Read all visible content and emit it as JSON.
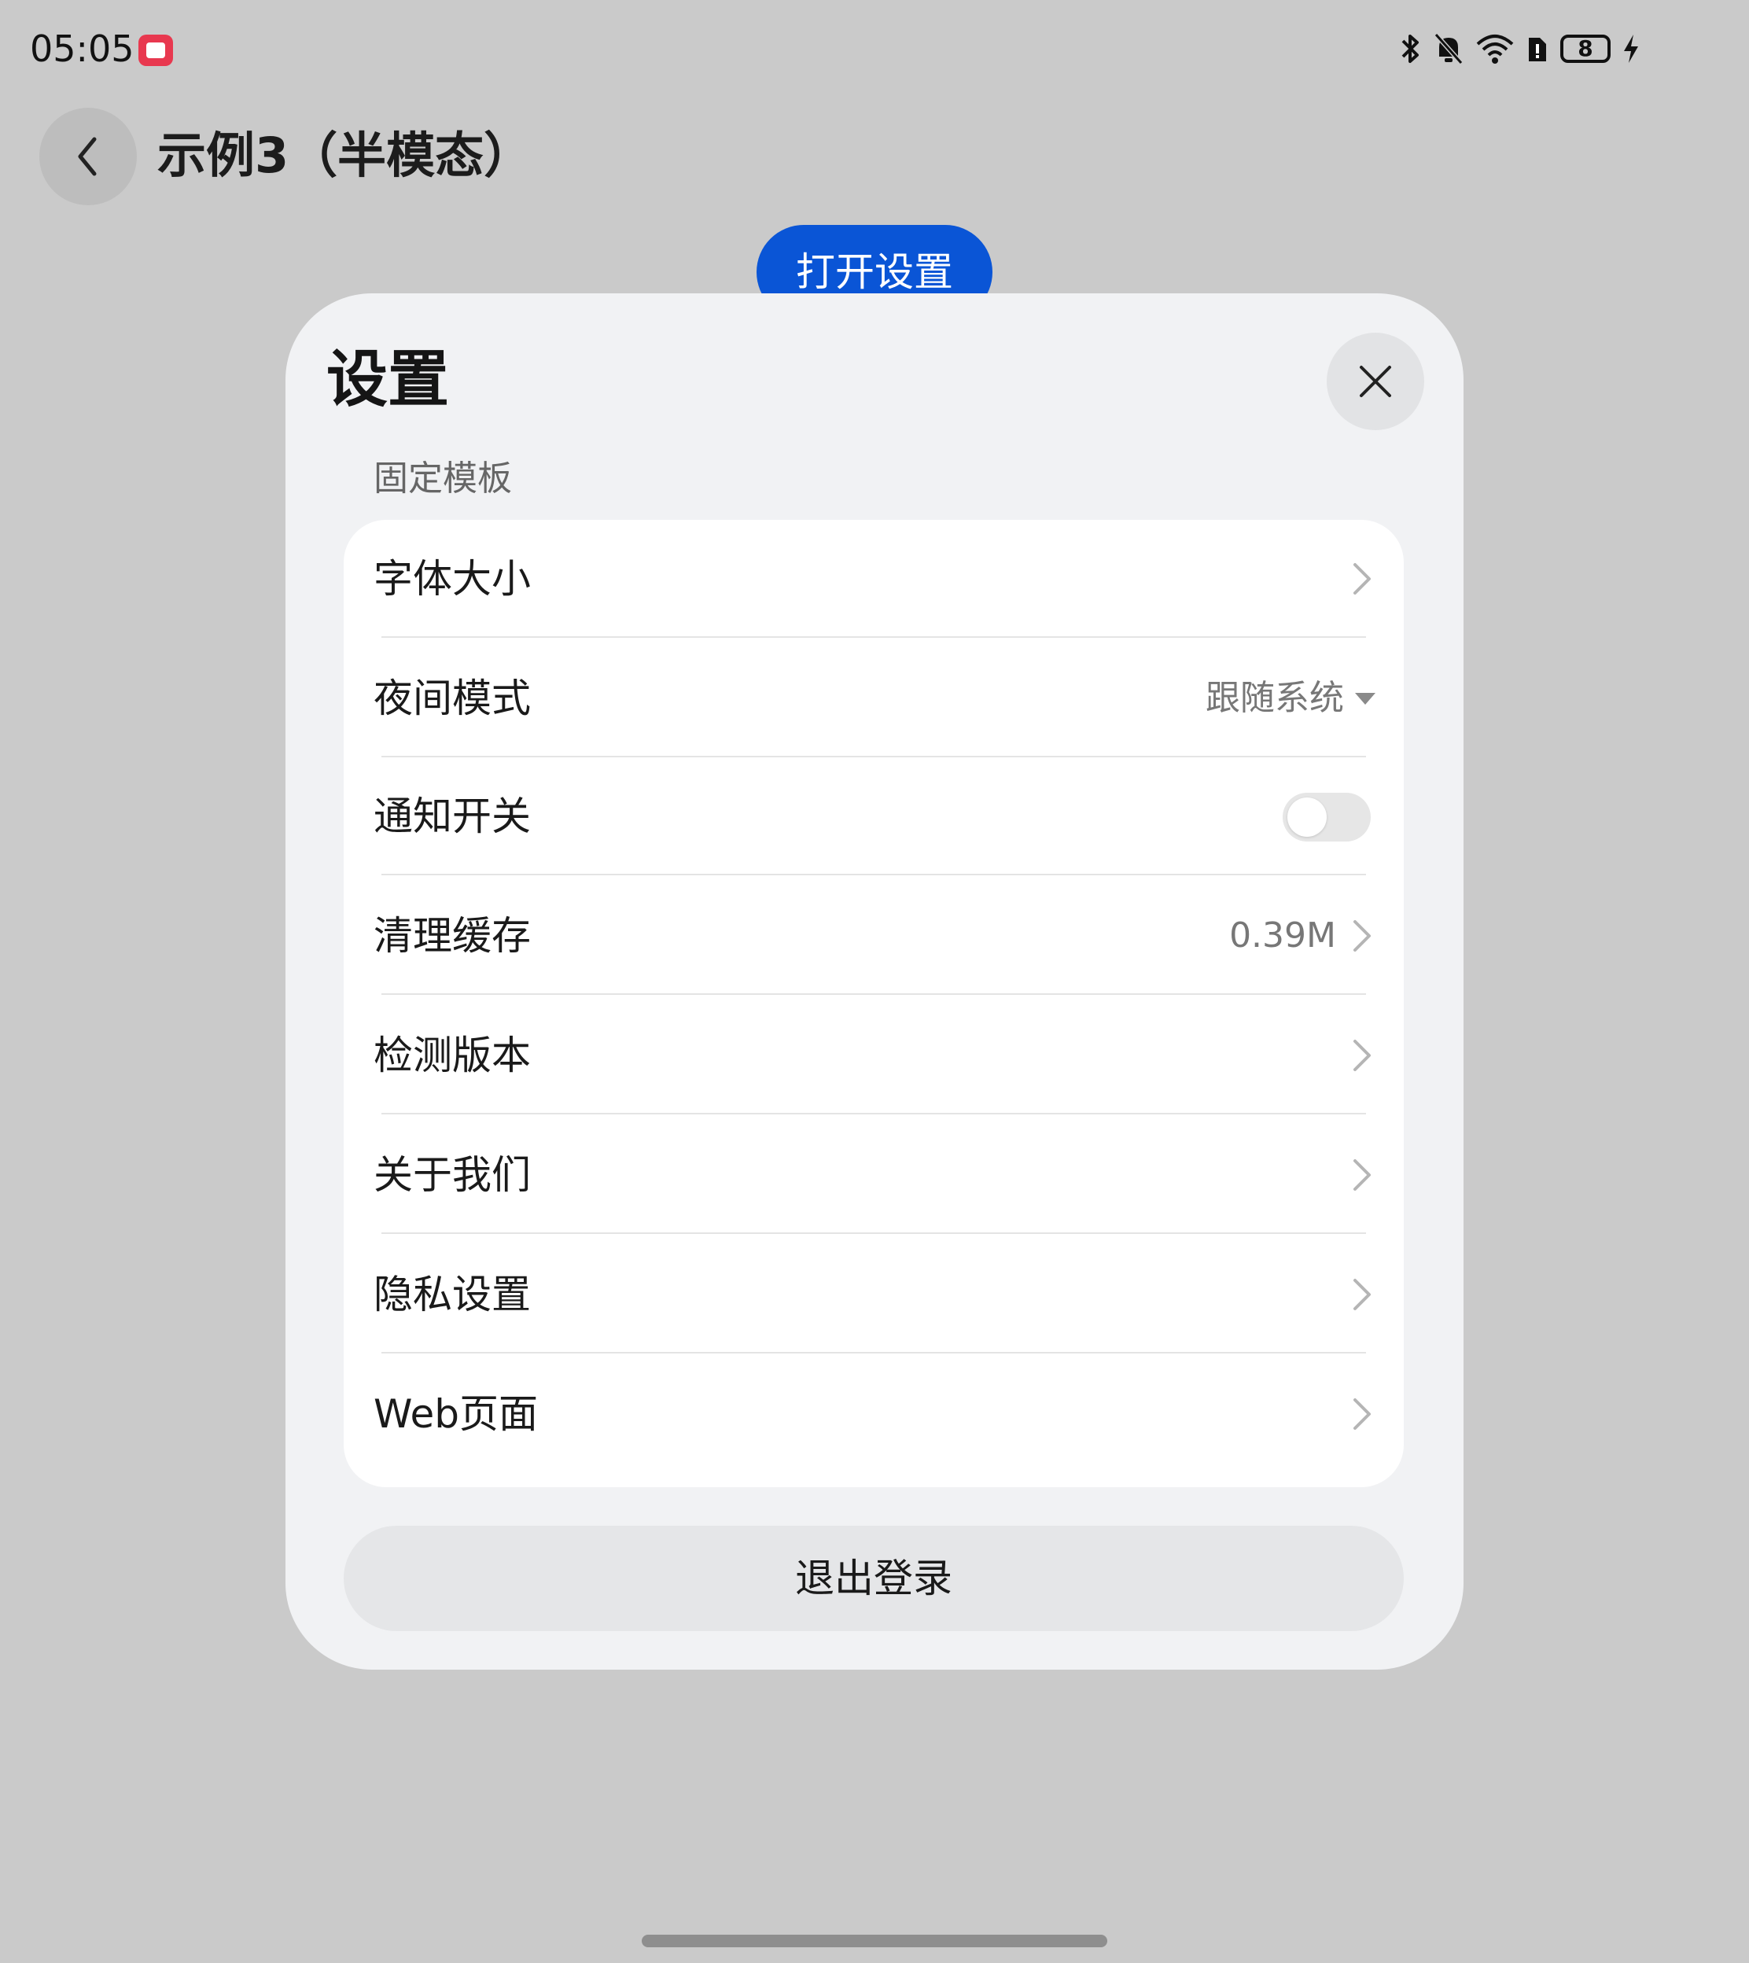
{
  "status_bar": {
    "time": "05:05",
    "app_icon": "notification-app-icon",
    "icons": [
      "bluetooth-icon",
      "mute-bell-icon",
      "wifi-icon",
      "sim-icon",
      "battery-icon",
      "charging-icon"
    ],
    "battery_level": "8"
  },
  "nav": {
    "back_icon": "chevron-left-icon",
    "title": "示例3（半模态）"
  },
  "open_settings_button": "打开设置",
  "sheet": {
    "title": "设置",
    "close_icon": "close-icon",
    "section_label": "固定模板",
    "rows": [
      {
        "label": "字体大小",
        "type": "link"
      },
      {
        "label": "夜间模式",
        "type": "select",
        "value": "跟随系统"
      },
      {
        "label": "通知开关",
        "type": "toggle",
        "checked": false
      },
      {
        "label": "清理缓存",
        "type": "link",
        "value": "0.39M"
      },
      {
        "label": "检测版本",
        "type": "link"
      },
      {
        "label": "关于我们",
        "type": "link"
      },
      {
        "label": "隐私设置",
        "type": "link"
      },
      {
        "label": "Web页面",
        "type": "link"
      }
    ],
    "logout_button": "退出登录"
  },
  "colors": {
    "primary": "#0a55d6",
    "background": "#cacaca",
    "sheet_bg": "#f1f2f4",
    "card_bg": "#ffffff"
  }
}
